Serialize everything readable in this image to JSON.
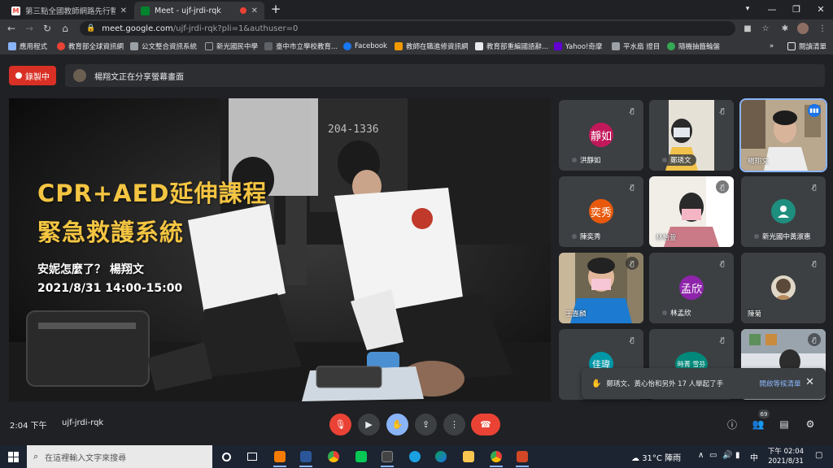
{
  "browser": {
    "tabs": [
      {
        "title": "第三點全國教師網路先行暫停報名",
        "active": false
      },
      {
        "title": "Meet - ujf-jrdi-rqk",
        "active": true
      }
    ],
    "new_tab_icon": "+",
    "url_host": "meet.google.com",
    "url_path": "/ujf-jrdi-rqk?pli=1&authuser=0",
    "bookmarks": [
      {
        "label": "應用程式",
        "color": "#8ab4f8"
      },
      {
        "label": "教育部全球資訊網",
        "color": "#ea4335"
      },
      {
        "label": "公文整合資訊系統",
        "color": "#9aa0a6"
      },
      {
        "label": "新光國民中學",
        "color": "#9aa0a6"
      },
      {
        "label": "臺中市立學校教育...",
        "color": "#5f6368"
      },
      {
        "label": "Facebook",
        "color": "#1877f2"
      },
      {
        "label": "教師在職進修資訊網",
        "color": "#f29900"
      },
      {
        "label": "教育部重編國語辭...",
        "color": "#e8eaed"
      },
      {
        "label": "Yahoo!奇摩",
        "color": "#6001d2"
      },
      {
        "label": "平水扇 證目",
        "color": "#9aa0a6"
      },
      {
        "label": "隨機抽籤輪盤",
        "color": "#34a853"
      }
    ],
    "reading_list": "閱讀清單",
    "bookmarks_more": "»"
  },
  "meet": {
    "recording_label": "錄製中",
    "presenting_text": "楊翔文正在分享螢幕畫面",
    "slide": {
      "title_line1": "CPR+AED延伸課程",
      "title_line2": "緊急救護系統",
      "subtitle": "安妮怎麼了？ 楊翔文",
      "datetime": "2021/8/31 14:00-15:00",
      "bg_text": "204-1336"
    },
    "participants": [
      {
        "name": "洪靜如",
        "initials": "靜如",
        "avatar_color": "#c2185b",
        "type": "avatar"
      },
      {
        "name": "鄭琇文",
        "type": "video"
      },
      {
        "name": "楊翔文",
        "type": "video",
        "speaking": true
      },
      {
        "name": "陳奕秀",
        "initials": "奕秀",
        "avatar_color": "#e8590c",
        "type": "avatar"
      },
      {
        "name": "林怡萱",
        "type": "video"
      },
      {
        "name": "新光國中黃淑惠",
        "type": "person-icon",
        "avatar_color": "#1e8e7e"
      },
      {
        "name": "王嘉麟",
        "type": "video"
      },
      {
        "name": "林孟欣",
        "initials": "孟欣",
        "avatar_color": "#8e24aa",
        "type": "avatar"
      },
      {
        "name": "陳菊",
        "type": "photo"
      },
      {
        "name": "",
        "initials": "佳瑋",
        "avatar_color": "#0097a7",
        "type": "avatar"
      },
      {
        "name": "",
        "initials": "時菁 雪芬",
        "avatar_color": "#00897b",
        "type": "avatar"
      },
      {
        "name": "",
        "type": "video"
      }
    ],
    "toast": {
      "message": "鄭琇文、黃心怡和另外 17 人舉起了手",
      "link": "開啟等候清單",
      "close": "✕"
    },
    "time": "2:04 下午",
    "meeting_code": "ujf-jrdi-rqk",
    "people_count": "69"
  },
  "taskbar": {
    "search_placeholder": "在這裡輸入文字來搜尋",
    "weather": "31°C  陣雨",
    "ime": "中",
    "clock_time": "下午 02:04",
    "clock_date": "2021/8/31",
    "apps": [
      {
        "name": "cortana",
        "color": "#ffffff"
      },
      {
        "name": "task-view",
        "color": "#ffffff"
      },
      {
        "name": "outlook",
        "color": "#f57c00"
      },
      {
        "name": "word",
        "color": "#2b579a"
      },
      {
        "name": "chrome",
        "color": "#fbbc04"
      },
      {
        "name": "line",
        "color": "#06c755"
      },
      {
        "name": "monitor",
        "color": "#444444"
      },
      {
        "name": "ie",
        "color": "#1ba1e2"
      },
      {
        "name": "edge",
        "color": "#0f9d58"
      },
      {
        "name": "explorer",
        "color": "#f9c74f"
      },
      {
        "name": "chrome-meet",
        "color": "#ea4335"
      },
      {
        "name": "powerpoint",
        "color": "#d24726"
      }
    ]
  }
}
